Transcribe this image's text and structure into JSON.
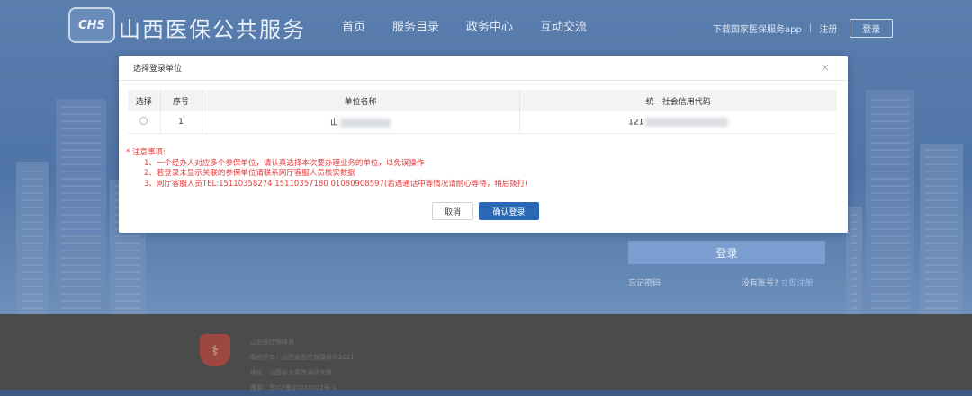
{
  "header": {
    "logo_text": "CHS",
    "site_title": "山西医保公共服务",
    "nav": [
      "首页",
      "服务目录",
      "政务中心",
      "互动交流"
    ],
    "download_app": "下载国家医保服务app",
    "separator": "|",
    "register": "注册",
    "login": "登录"
  },
  "login_panel": {
    "login_button": "登录",
    "forgot": "忘记密码",
    "no_account": "没有账号?",
    "register_now": "立即注册"
  },
  "footer": {
    "lines": [
      "山西医疗保障局",
      "版权所有：山西省医疗保障局©2021",
      "地址：山西省太原市通达大厦",
      "备案：晋ICP备20210021号-1"
    ]
  },
  "dialog": {
    "title": "选择登录单位",
    "close": "×",
    "columns": [
      "选择",
      "序号",
      "单位名称",
      "统一社会信用代码"
    ],
    "rows": [
      {
        "index": "1",
        "unit_name": "山",
        "credit_code": "121"
      }
    ],
    "notes_title": "* 注意事项:",
    "notes": [
      "1、一个经办人对应多个参保单位，请认真选择本次要办理业务的单位，以免误操作",
      "2、若登录未显示关联的参保单位请联系网厅客服人员核实数据",
      "3、网厅客服人员TEL:15110358274 15110357180 01080908597(若遇通话中等情况请耐心等待，稍后拨打)"
    ],
    "cancel": "取消",
    "confirm": "确认登录"
  },
  "colors": {
    "primary": "#2a68b5",
    "warning_text": "#e63b3b"
  }
}
